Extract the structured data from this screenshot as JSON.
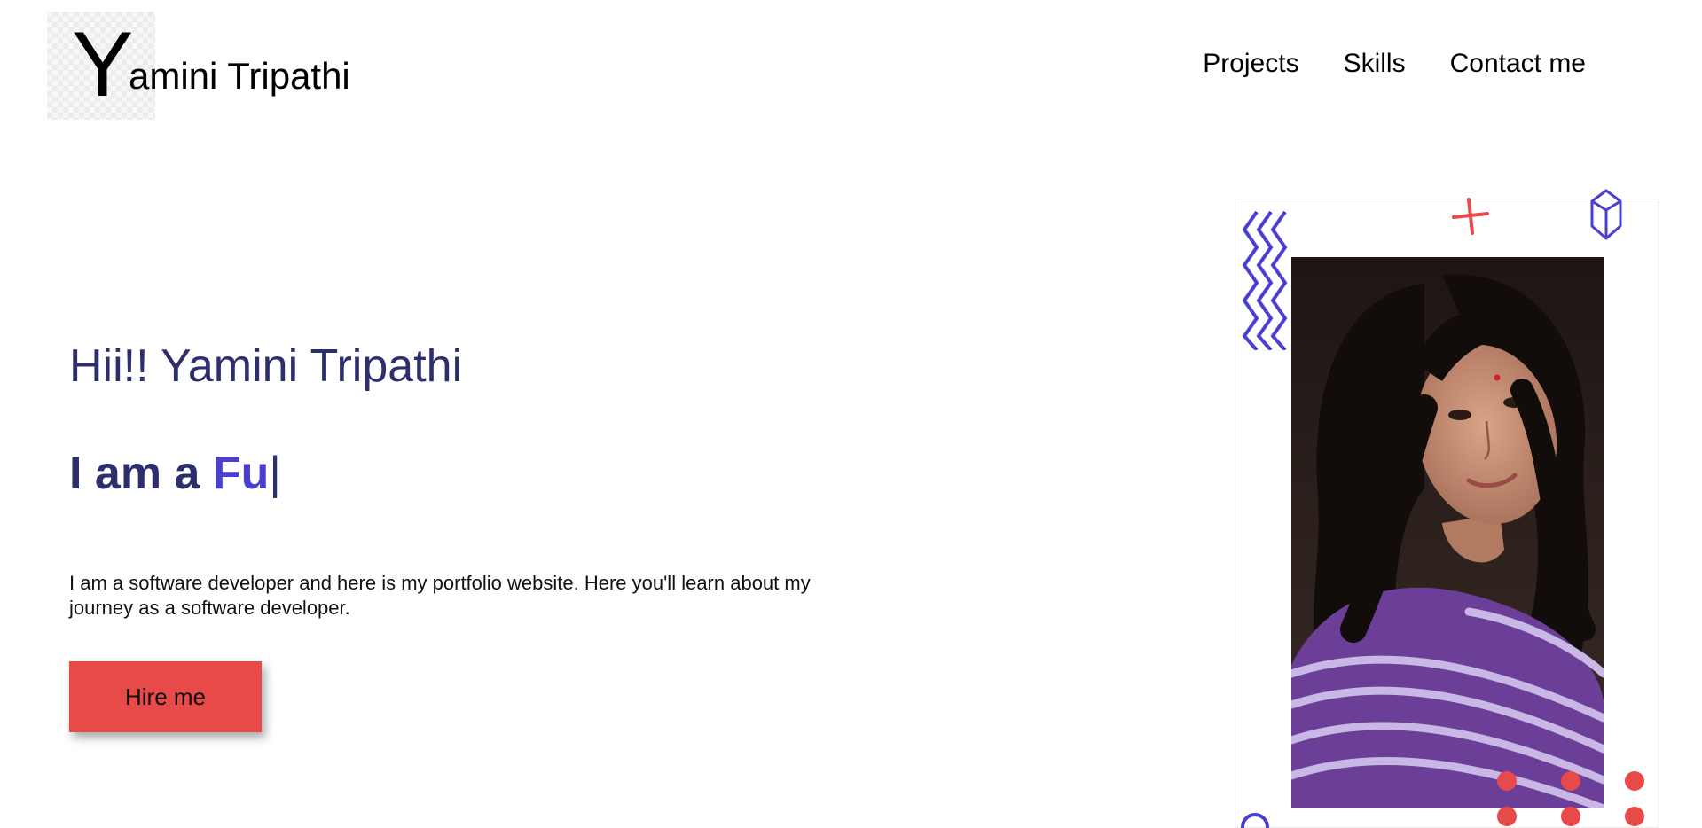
{
  "header": {
    "logo_letter": "Y",
    "logo_name": "amini Tripathi",
    "nav": [
      {
        "label": "Projects"
      },
      {
        "label": "Skills"
      },
      {
        "label": "Contact me"
      }
    ]
  },
  "hero": {
    "greeting": "Hii!! Yamini Tripathi",
    "role_prefix": "I am a ",
    "role_typed": "Fu",
    "role_cursor": "|",
    "description": "I am a software developer and here is my portfolio website. Here you'll learn about my journey as a software developer.",
    "cta_label": "Hire me"
  },
  "colors": {
    "accent_red": "#e84949",
    "accent_blue": "#4b3fd1",
    "heading": "#2c2f6b"
  },
  "icons": {
    "zigzag": "zigzag-icon",
    "plus": "plus-icon",
    "crystal": "crystal-icon",
    "dots": "dots-icon",
    "circle": "circle-icon"
  }
}
